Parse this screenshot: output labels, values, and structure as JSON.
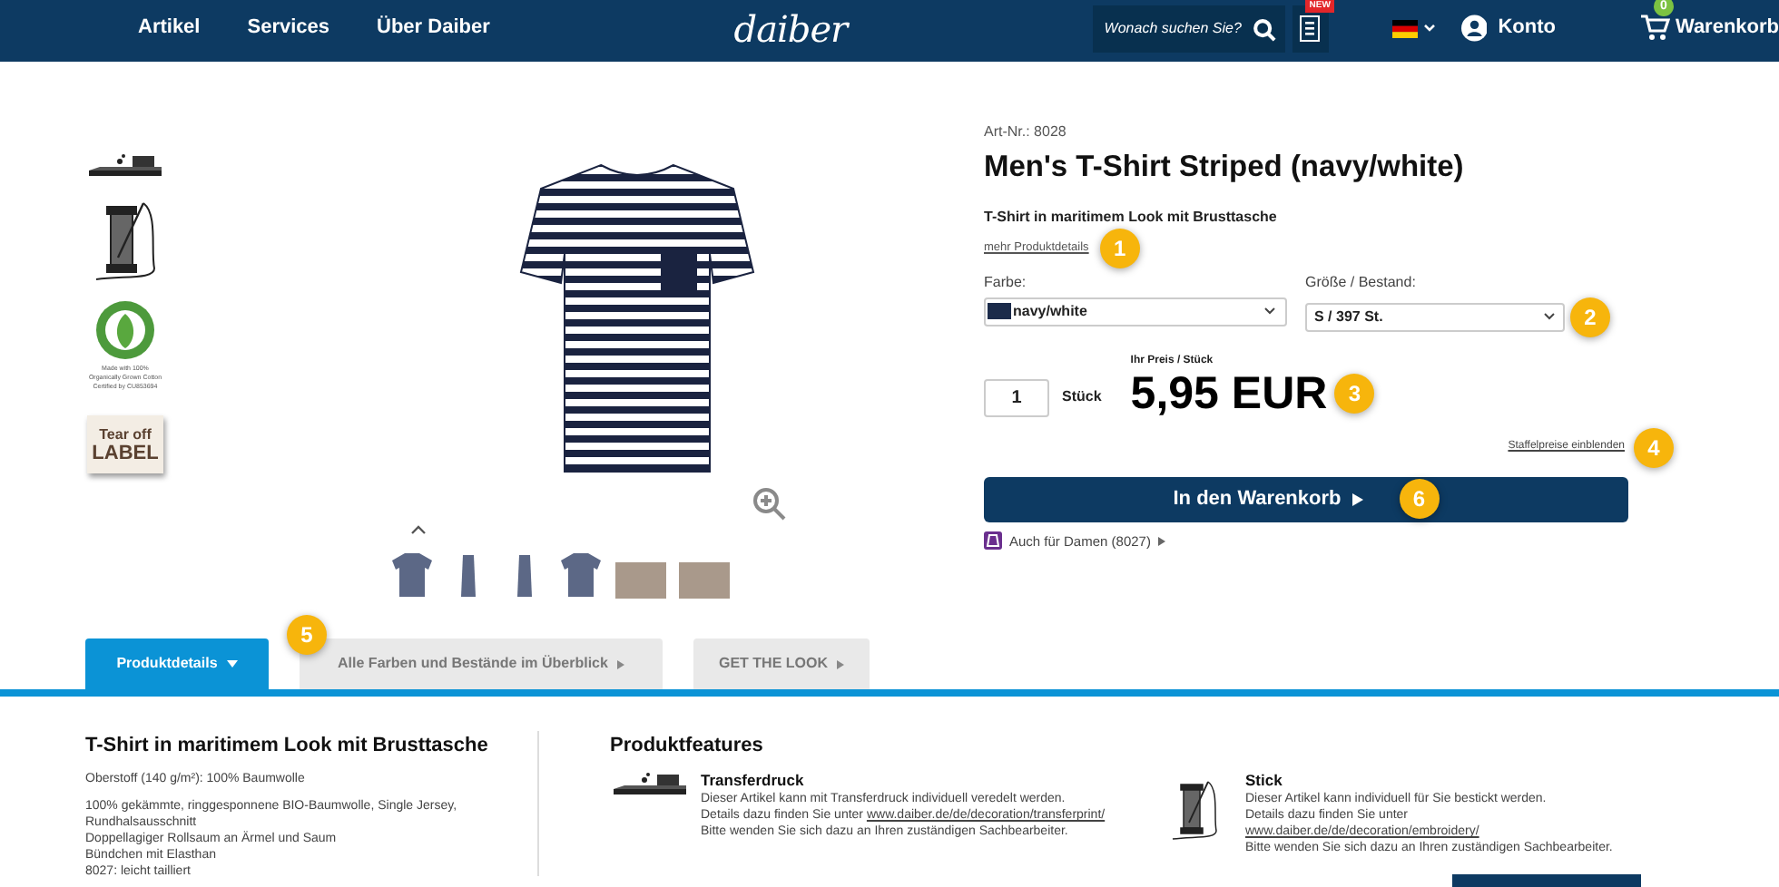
{
  "header": {
    "nav": [
      "Artikel",
      "Services",
      "Über Daiber"
    ],
    "logo": "daiber",
    "search": {
      "placeholder": "Wonach suchen Sie?"
    },
    "new_badge": "NEW",
    "account": "Konto",
    "cart": {
      "label": "Warenkorb",
      "count": "0"
    }
  },
  "side_features": [
    {
      "kind": "print"
    },
    {
      "kind": "thread"
    },
    {
      "kind": "organic",
      "caption": [
        "Made with 100%",
        "Organically Grown Cotton",
        "Certified by CU853694"
      ]
    },
    {
      "kind": "label",
      "text": [
        "Tear off",
        "LABEL"
      ]
    }
  ],
  "thumbnails": [
    {
      "kind": "front"
    },
    {
      "kind": "side"
    },
    {
      "kind": "side"
    },
    {
      "kind": "back"
    },
    {
      "kind": "photo"
    },
    {
      "kind": "photo"
    }
  ],
  "product": {
    "art_nr": "Art-Nr.: 8028",
    "title": "Men's T-Shirt Striped (navy/white)",
    "subtitle": "T-Shirt in maritimem Look mit Brusttasche",
    "more_link": {
      "text": "mehr Produktdetails",
      "marker": "1"
    },
    "color": {
      "label": "Farbe:",
      "value": "navy/white"
    },
    "size": {
      "label": "Größe / Bestand:",
      "value": "S / 397 St.",
      "marker": "2"
    },
    "quantity": "1",
    "unit": "Stück",
    "price_label": "Ihr Preis / Stück",
    "price": {
      "text": "5,95 EUR",
      "marker": "3"
    },
    "scale_link": {
      "text": "Staffelpreise einblenden",
      "marker": "4"
    },
    "cart_button": {
      "text": "In den Warenkorb",
      "marker": "6"
    },
    "also": "Auch für Damen (8027)"
  },
  "tabs": [
    {
      "label": "Produktdetails",
      "selected": true
    },
    {
      "label": "Alle Farben und Bestände im Überblick",
      "selected": false,
      "marker": "5"
    },
    {
      "label": "GET THE LOOK",
      "selected": false
    }
  ],
  "details": {
    "heading": "T-Shirt in maritimem Look mit Brusttasche",
    "material": "Oberstoff (140 g/m²): 100% Baumwolle",
    "lines": [
      "100% gekämmte, ringgesponnene BIO-Baumwolle, Single Jersey, Rundhalsausschnitt",
      "Doppellagiger Rollsaum an Ärmel und Saum",
      "Bündchen mit Elasthan",
      "8027: leicht tailliert"
    ]
  },
  "features": {
    "heading": "Produktfeatures",
    "items": [
      {
        "kind": "print",
        "title": "Transferdruck",
        "lines": [
          {
            "text": "Dieser Artikel kann mit Transferdruck individuell veredelt werden."
          },
          {
            "text": "Details dazu finden Sie unter ",
            "link": "www.daiber.de/de/decoration/transferprint/"
          },
          {
            "text": "Bitte wenden Sie sich dazu an Ihren zuständigen Sachbearbeiter."
          }
        ]
      },
      {
        "kind": "thread",
        "title": "Stick",
        "lines": [
          {
            "text": "Dieser Artikel kann individuell für Sie bestickt werden."
          },
          {
            "text": "Details dazu finden Sie unter"
          },
          {
            "link": "www.daiber.de/de/decoration/embroidery/"
          },
          {
            "text": "Bitte wenden Sie sich dazu an Ihren zuständigen Sachbearbeiter."
          }
        ]
      }
    ]
  }
}
